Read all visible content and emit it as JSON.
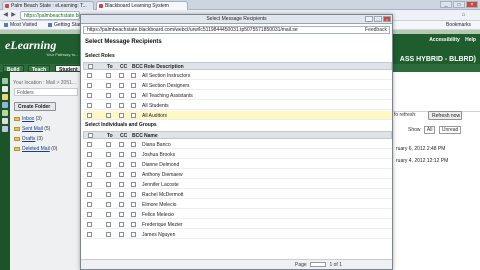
{
  "browser": {
    "tabs": [
      {
        "label": "Palm Beach State : eLearning: T..."
      },
      {
        "label": "Blackboard Learning System"
      }
    ],
    "main_address": "https://palmbeachstate.blackboard.com/webct/cobaltMainFrame.dowebct",
    "bookmarks": [
      "Most Visited",
      "Getting Star"
    ],
    "bookmarks_right": "Bookmarks"
  },
  "site": {
    "brand": "eLearning",
    "subtitle": "Your Pathway to...",
    "links": [
      "Accessibility",
      "Help"
    ],
    "course_title": "ASS HYBRID - BLBRD)"
  },
  "control_tabs": [
    "Build",
    "Teach",
    "Student"
  ],
  "sidebar": {
    "location": "Your location : Mail > 2051...",
    "folders_label": "Folders",
    "create_folder": "Create Folder",
    "mail_folders": [
      {
        "name": "Inbox",
        "count": "(3)"
      },
      {
        "name": "Sent Mail",
        "count": "(5)"
      },
      {
        "name": "Drafts",
        "count": "(3)"
      },
      {
        "name": "Deleted Mail",
        "count": "(0)"
      }
    ]
  },
  "right_pane": {
    "refresh_prefix": "fo refresh:",
    "refresh_button": "Refresh now",
    "show_label": "Show",
    "show_value": "All",
    "unread_value": "Unread",
    "dates": [
      "ruary 6, 2012 2:48 PM",
      "ruary 4, 2012 12:12 PM"
    ]
  },
  "modal": {
    "window_title": "Select Message Recipients",
    "address": "https://palmbeachstate.blackboard.com/webct/urw/lc5119844450031.tp5075571850031/mail.se",
    "feedback": "Feedback",
    "heading": "Select Message Recipients",
    "roles_section": "Select Roles",
    "roles_columns": [
      "To",
      "CC",
      "BCC",
      "Role Description"
    ],
    "roles": [
      "All Section Instructors",
      "All Section Designers",
      "All Teaching Assistants",
      "All Students",
      "All Auditors"
    ],
    "individuals_section": "Select Individuals and Groups",
    "individuals_columns": [
      "To",
      "CC",
      "BCC",
      "Name"
    ],
    "individuals": [
      "Diana Banco",
      "Joshua Brooks",
      "Dianne Delmond",
      "Anthony Diemaew",
      "Jennifer Lacoste",
      "Rachel McDermott",
      "Elmore Melecio",
      "Felice Melecio",
      "Frederique Mezier",
      "James Nguyen"
    ],
    "pager_label": "Page",
    "pager_of": "1 of 1"
  }
}
